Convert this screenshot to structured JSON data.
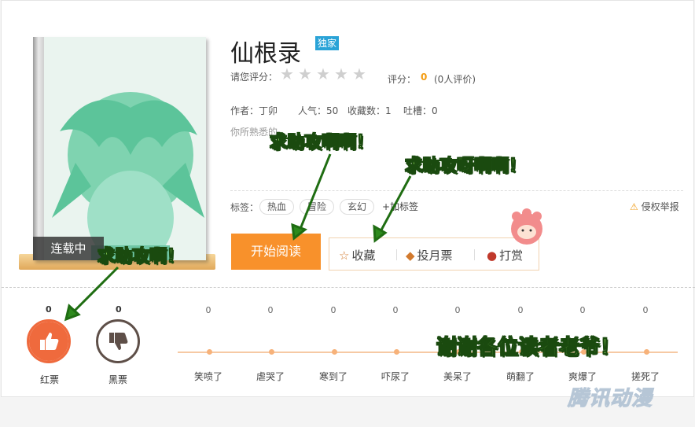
{
  "book": {
    "title": "仙根录",
    "exclusive_badge": "独家",
    "cover_status": "连载中",
    "rate_prompt": "请您评分：",
    "star_icons": [
      "star-icon",
      "star-icon",
      "star-icon",
      "star-icon",
      "star-icon"
    ],
    "score_label": "评分：",
    "score_value": "0",
    "score_count": "(0人评价)",
    "meta": {
      "author": "作者：丁卯",
      "popularity": "人气：50",
      "favorites": "收藏数：1",
      "comments": "吐槽：0"
    },
    "description_partial": "你所熟悉的"
  },
  "tags": {
    "label": "标签：",
    "items": [
      "热血",
      "冒险",
      "玄幻"
    ],
    "add_label": "+加标签",
    "report_label": "侵权举报"
  },
  "actions": {
    "read_label": "开始阅读",
    "collect_label": "收藏",
    "monthly_label": "投月票",
    "tip_label": "打赏"
  },
  "votes": {
    "red": {
      "count": "0",
      "label": "红票"
    },
    "black": {
      "count": "0",
      "label": "黑票"
    }
  },
  "reactions": [
    {
      "label": "笑喷了",
      "count": "0"
    },
    {
      "label": "虐哭了",
      "count": "0"
    },
    {
      "label": "寒到了",
      "count": "0"
    },
    {
      "label": "吓尿了",
      "count": "0"
    },
    {
      "label": "美呆了",
      "count": "0"
    },
    {
      "label": "萌翻了",
      "count": "0"
    },
    {
      "label": "爽爆了",
      "count": "0"
    },
    {
      "label": "搓死了",
      "count": "0"
    }
  ],
  "annotations": {
    "a1": "求助攻啊啊！",
    "a2": "求助攻呀啊啊！",
    "a3": "求助攻啊！",
    "a4": "谢谢各位读者老爷！"
  },
  "watermark": "腾讯动漫",
  "colors": {
    "accent_orange": "#f8912b",
    "badge_blue": "#2aa3d7",
    "red_vote": "#ef6a3d",
    "annotation_green": "#8fd65a"
  }
}
